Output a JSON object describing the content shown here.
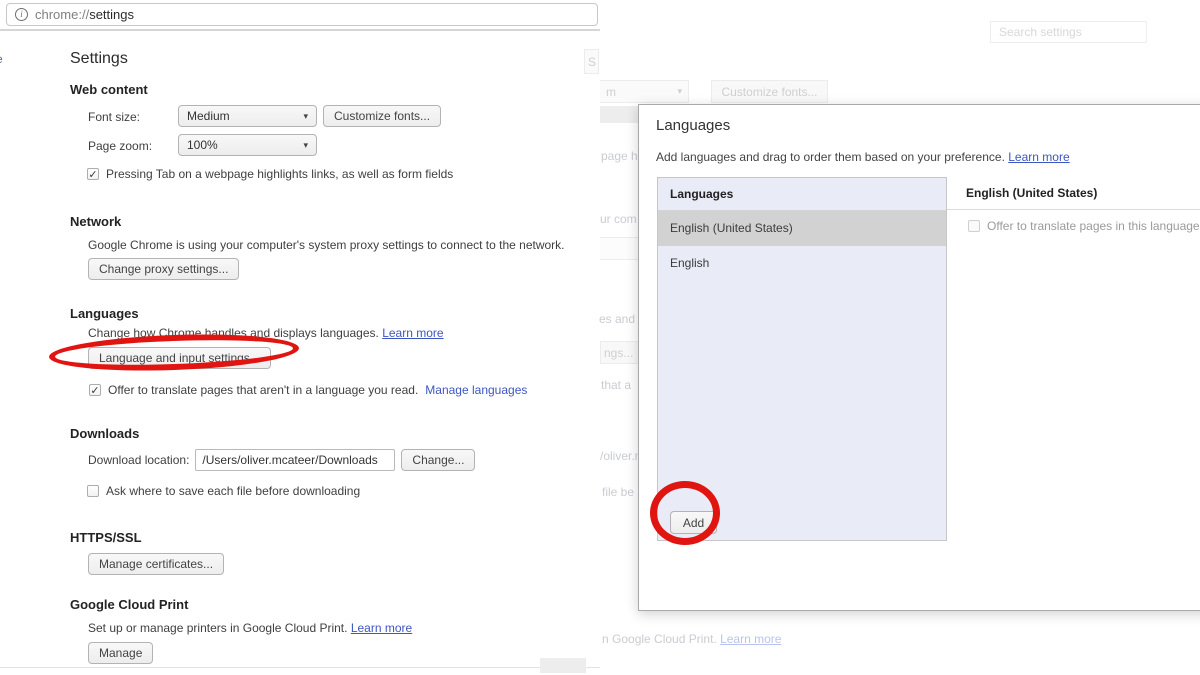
{
  "icons": {
    "check": "✓",
    "dropdown_arrow": "▾",
    "info": "i"
  },
  "colors": {
    "annotation_red": "#e01511",
    "link_blue": "#3d56c4",
    "selected_row_gray": "#d2d2d2",
    "language_pane_lavender": "#e9ebf6"
  },
  "browser": {
    "url_scheme": "chrome://",
    "url_host": "settings"
  },
  "edge_fragment": "e",
  "left": {
    "title": "Settings",
    "web_content": {
      "header": "Web content",
      "font_size_label": "Font size:",
      "font_size_value": "Medium",
      "customize_fonts_button": "Customize fonts...",
      "page_zoom_label": "Page zoom:",
      "page_zoom_value": "100%",
      "tab_checkbox_label": "Pressing Tab on a webpage highlights links, as well as form fields"
    },
    "network": {
      "header": "Network",
      "desc": "Google Chrome is using your computer's system proxy settings to connect to the network.",
      "proxy_button": "Change proxy settings..."
    },
    "languages": {
      "header": "Languages",
      "desc": "Change how Chrome handles and displays languages.",
      "learn_more": "Learn more",
      "settings_button": "Language and input settings...",
      "translate_checkbox_label": "Offer to translate pages that aren't in a language you read.",
      "manage_link": "Manage languages"
    },
    "downloads": {
      "header": "Downloads",
      "location_label": "Download location:",
      "location_value": "/Users/oliver.mcateer/Downloads",
      "change_button": "Change...",
      "ask_checkbox_label": "Ask where to save each file before downloading"
    },
    "https_ssl": {
      "header": "HTTPS/SSL",
      "certificates_button": "Manage certificates..."
    },
    "cloud_print": {
      "header": "Google Cloud Print",
      "desc": "Set up or manage printers in Google Cloud Print.",
      "learn_more": "Learn more",
      "manage_button": "Manage"
    }
  },
  "right_bg": {
    "search_placeholder": "Search settings",
    "fragments": {
      "search_s": "S",
      "select_m": "m",
      "customize_fonts": "Customize fonts...",
      "page_hi": "page hi",
      "ur_com": "ur com",
      "es_and": "es and",
      "ngs": "ngs...",
      "that_a": "that a",
      "oliver": "/oliver.m",
      "file_be": "file be",
      "cloud_print": "n Google Cloud Print.",
      "learn_more": "Learn more"
    }
  },
  "dialog": {
    "title": "Languages",
    "subtitle": "Add languages and drag to order them based on your preference.",
    "learn_more": "Learn more",
    "list_header": "Languages",
    "items": [
      {
        "label": "English (United States)"
      },
      {
        "label": "English"
      }
    ],
    "add_button": "Add",
    "detail_header": "English (United States)",
    "translate_checkbox_label": "Offer to translate pages in this language"
  }
}
